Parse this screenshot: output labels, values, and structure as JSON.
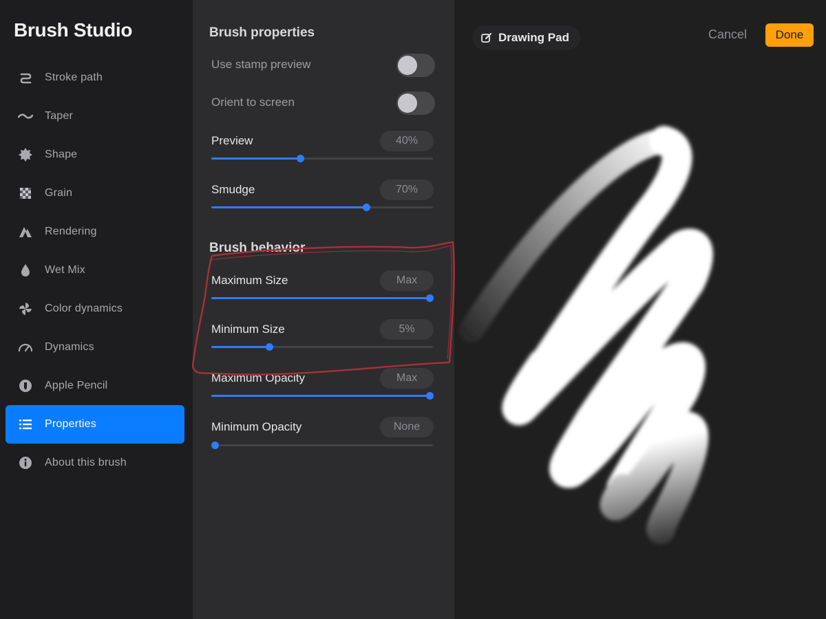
{
  "sidebar": {
    "title": "Brush Studio",
    "items": [
      {
        "label": "Stroke path",
        "icon": "stroke-path-icon",
        "active": false
      },
      {
        "label": "Taper",
        "icon": "taper-icon",
        "active": false
      },
      {
        "label": "Shape",
        "icon": "shape-icon",
        "active": false
      },
      {
        "label": "Grain",
        "icon": "grain-icon",
        "active": false
      },
      {
        "label": "Rendering",
        "icon": "rendering-icon",
        "active": false
      },
      {
        "label": "Wet Mix",
        "icon": "wet-mix-icon",
        "active": false
      },
      {
        "label": "Color dynamics",
        "icon": "color-dynamics-icon",
        "active": false
      },
      {
        "label": "Dynamics",
        "icon": "dynamics-icon",
        "active": false
      },
      {
        "label": "Apple Pencil",
        "icon": "apple-pencil-icon",
        "active": false
      },
      {
        "label": "Properties",
        "icon": "properties-icon",
        "active": true
      },
      {
        "label": "About this brush",
        "icon": "about-icon",
        "active": false
      }
    ]
  },
  "panel": {
    "brush_properties": {
      "title": "Brush properties",
      "toggles": [
        {
          "label": "Use stamp preview",
          "on": false
        },
        {
          "label": "Orient to screen",
          "on": false
        }
      ],
      "sliders": [
        {
          "label": "Preview",
          "value": "40%",
          "fraction": 0.4
        },
        {
          "label": "Smudge",
          "value": "70%",
          "fraction": 0.7
        }
      ]
    },
    "brush_behavior": {
      "title": "Brush behavior",
      "sliders": [
        {
          "label": "Maximum Size",
          "value": "Max",
          "fraction": 1.0
        },
        {
          "label": "Minimum Size",
          "value": "5%",
          "fraction": 0.26
        },
        {
          "label": "Maximum Opacity",
          "value": "Max",
          "fraction": 1.0
        },
        {
          "label": "Minimum Opacity",
          "value": "None",
          "fraction": 0.0
        }
      ]
    }
  },
  "canvas": {
    "drawing_pad_label": "Drawing Pad",
    "cancel_label": "Cancel",
    "done_label": "Done"
  },
  "colors": {
    "accent": "#0a7cff",
    "slider": "#2f7cf6",
    "done": "#ff9f0a",
    "annotation": "#a8303a"
  }
}
